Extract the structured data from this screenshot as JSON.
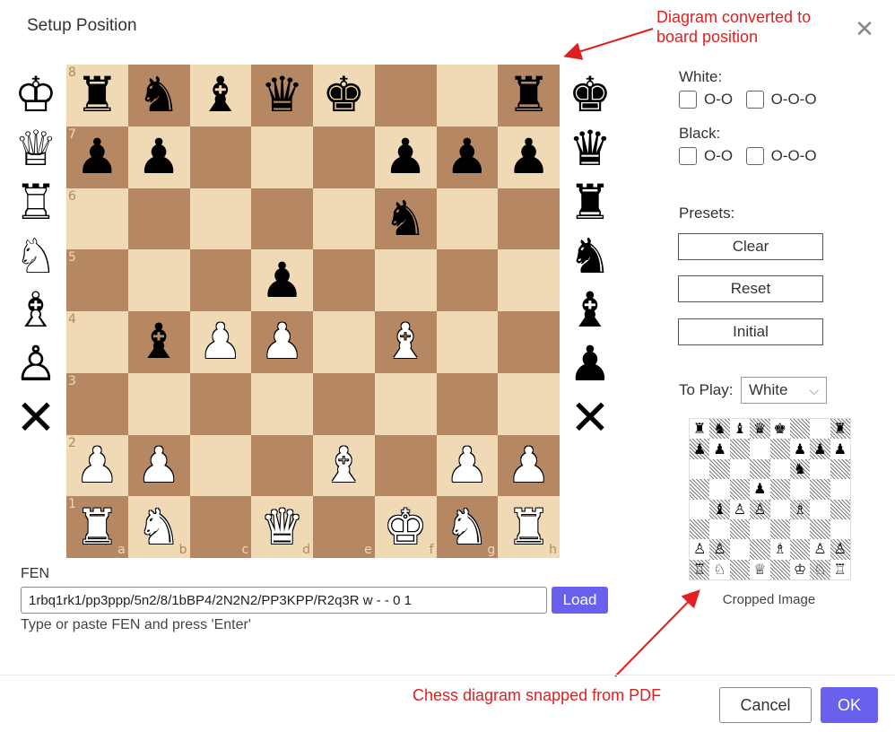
{
  "dialog": {
    "title": "Setup Position",
    "close_glyph": "✕"
  },
  "annotations": {
    "top_note": "Diagram converted to\nboard position",
    "bottom_note": "Chess diagram snapped from PDF"
  },
  "palette": {
    "white": [
      "♔",
      "♕",
      "♖",
      "♘",
      "♗",
      "♙",
      "✕"
    ],
    "black": [
      "♚",
      "♛",
      "♜",
      "♞",
      "♝",
      "♟",
      "✕"
    ]
  },
  "board": {
    "ranks": [
      "8",
      "7",
      "6",
      "5",
      "4",
      "3",
      "2",
      "1"
    ],
    "files": [
      "a",
      "b",
      "c",
      "d",
      "e",
      "f",
      "g",
      "h"
    ],
    "rows": [
      [
        "r",
        "n",
        "b",
        "q",
        "k",
        "",
        "",
        "r"
      ],
      [
        "p",
        "p",
        "",
        "",
        "",
        "p",
        "p",
        "p"
      ],
      [
        "",
        "",
        "",
        "",
        "",
        "n",
        "",
        ""
      ],
      [
        "",
        "",
        "",
        "p",
        "",
        "",
        "",
        ""
      ],
      [
        "",
        "b",
        "P",
        "P",
        "",
        "B",
        "",
        ""
      ],
      [
        "",
        "",
        "",
        "",
        "",
        "",
        "",
        ""
      ],
      [
        "P",
        "P",
        "",
        "",
        "B",
        "",
        "P",
        "P"
      ],
      [
        "R",
        "N",
        "",
        "Q",
        "",
        "K",
        "N",
        "R"
      ]
    ]
  },
  "castling": {
    "white_label": "White:",
    "black_label": "Black:",
    "kingside": "O-O",
    "queenside": "O-O-O"
  },
  "presets": {
    "label": "Presets:",
    "clear": "Clear",
    "reset": "Reset",
    "initial": "Initial"
  },
  "to_play": {
    "label": "To Play:",
    "value": "White",
    "chevron": "⌵"
  },
  "cropped_image": {
    "caption": "Cropped Image",
    "rows": [
      [
        "r",
        "n",
        "b",
        "q",
        "k",
        "",
        "",
        "r"
      ],
      [
        "p",
        "p",
        "",
        "",
        "",
        "p",
        "p",
        "p"
      ],
      [
        "",
        "",
        "",
        "",
        "",
        "n",
        "",
        ""
      ],
      [
        "",
        "",
        "",
        "p",
        "",
        "",
        "",
        ""
      ],
      [
        "",
        "b",
        "P",
        "P",
        "",
        "B",
        "",
        ""
      ],
      [
        "",
        "",
        "",
        "",
        "",
        "",
        "",
        ""
      ],
      [
        "P",
        "P",
        "",
        "",
        "B",
        "",
        "P",
        "P"
      ],
      [
        "R",
        "N",
        "",
        "Q",
        "",
        "K",
        "N",
        "R"
      ]
    ]
  },
  "fen": {
    "label": "FEN",
    "value": "1rbq1rk1/pp3ppp/5n2/8/1bBP4/2N2N2/PP3KPP/R2q3R w - - 0 1",
    "load": "Load",
    "hint": "Type or paste FEN and press 'Enter'"
  },
  "footer": {
    "cancel": "Cancel",
    "ok": "OK"
  },
  "colors": {
    "light_square": "#f0d9b5",
    "dark_square": "#b58863",
    "accent": "#6a60ee",
    "annotation": "#e21e1e"
  }
}
